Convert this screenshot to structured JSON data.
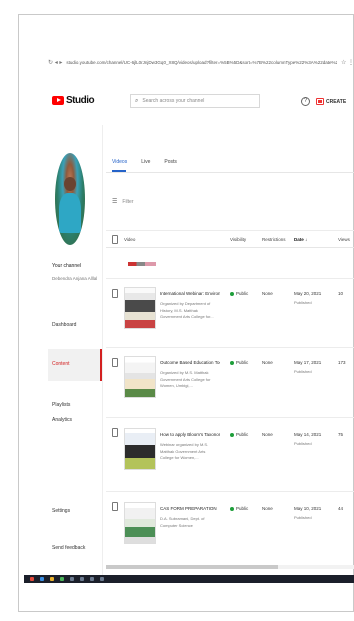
{
  "browser": {
    "url": "studio.youtube.com/channel/UC-6jlL0rJnjDw3Gq0_X8Q/videos/upload?filter=%5B%5D&sort=%7B%22columnType%22%3A%22date%22%2C%22sortOrder%22%3A%22DESCENDING%22%7D",
    "nav_icons": "↻ ◂ ▸",
    "ext_icons": "☆ ⋮"
  },
  "topbar": {
    "logo_text": "Studio",
    "search_placeholder": "Search across your channel",
    "help_icon": "?",
    "create_label": "CREATE"
  },
  "sidebar": {
    "channel_label": "Your channel",
    "channel_name": "Debendra Anjana Alllal",
    "items": [
      {
        "label": "Dashboard"
      },
      {
        "label": "Content"
      },
      {
        "label": "Playlists"
      },
      {
        "label": "Analytics"
      },
      {
        "label": "Settings"
      },
      {
        "label": "Send feedback"
      }
    ]
  },
  "main": {
    "tabs": [
      {
        "label": "Videos",
        "active": true
      },
      {
        "label": "Live",
        "active": false
      },
      {
        "label": "Posts",
        "active": false
      }
    ],
    "filter_label": "Filter",
    "columns": {
      "video": "Video",
      "visibility": "Visibility",
      "restrictions": "Restrictions",
      "date": "Date ↓",
      "views": "Views"
    },
    "rows": [
      {
        "title": "International Webinar: Environmental S...",
        "desc": "Organized by Department of History, M.S. Matthak Government Arts College for...",
        "visibility": "Public",
        "restrictions": "None",
        "date": "May 20, 2021",
        "date_status": "Published",
        "views": "10"
      },
      {
        "title": "Outcome Based Education Tools and...",
        "desc": "Organized by M.S. Matthak Government Arts College for Women, Umbigi,...",
        "visibility": "Public",
        "restrictions": "None",
        "date": "May 17, 2021",
        "date_status": "Published",
        "views": "173"
      },
      {
        "title": "How to apply Bloom's Taxonomy in Te...",
        "desc": "Webinar organized by M.S. Matthak Government Arts College for Women,...",
        "visibility": "Public",
        "restrictions": "None",
        "date": "May 14, 2021",
        "date_status": "Published",
        "views": "75"
      },
      {
        "title": "CAS FORM PREPARATION",
        "desc": "D.A. Subramani, Dept. of Computer Science",
        "visibility": "Public",
        "restrictions": "None",
        "date": "May 10, 2021",
        "date_status": "Published",
        "views": "44"
      }
    ]
  },
  "colors": {
    "accent_blue": "#2563c9",
    "brand_red": "#ff0000",
    "public_green": "#1e9e3a"
  }
}
